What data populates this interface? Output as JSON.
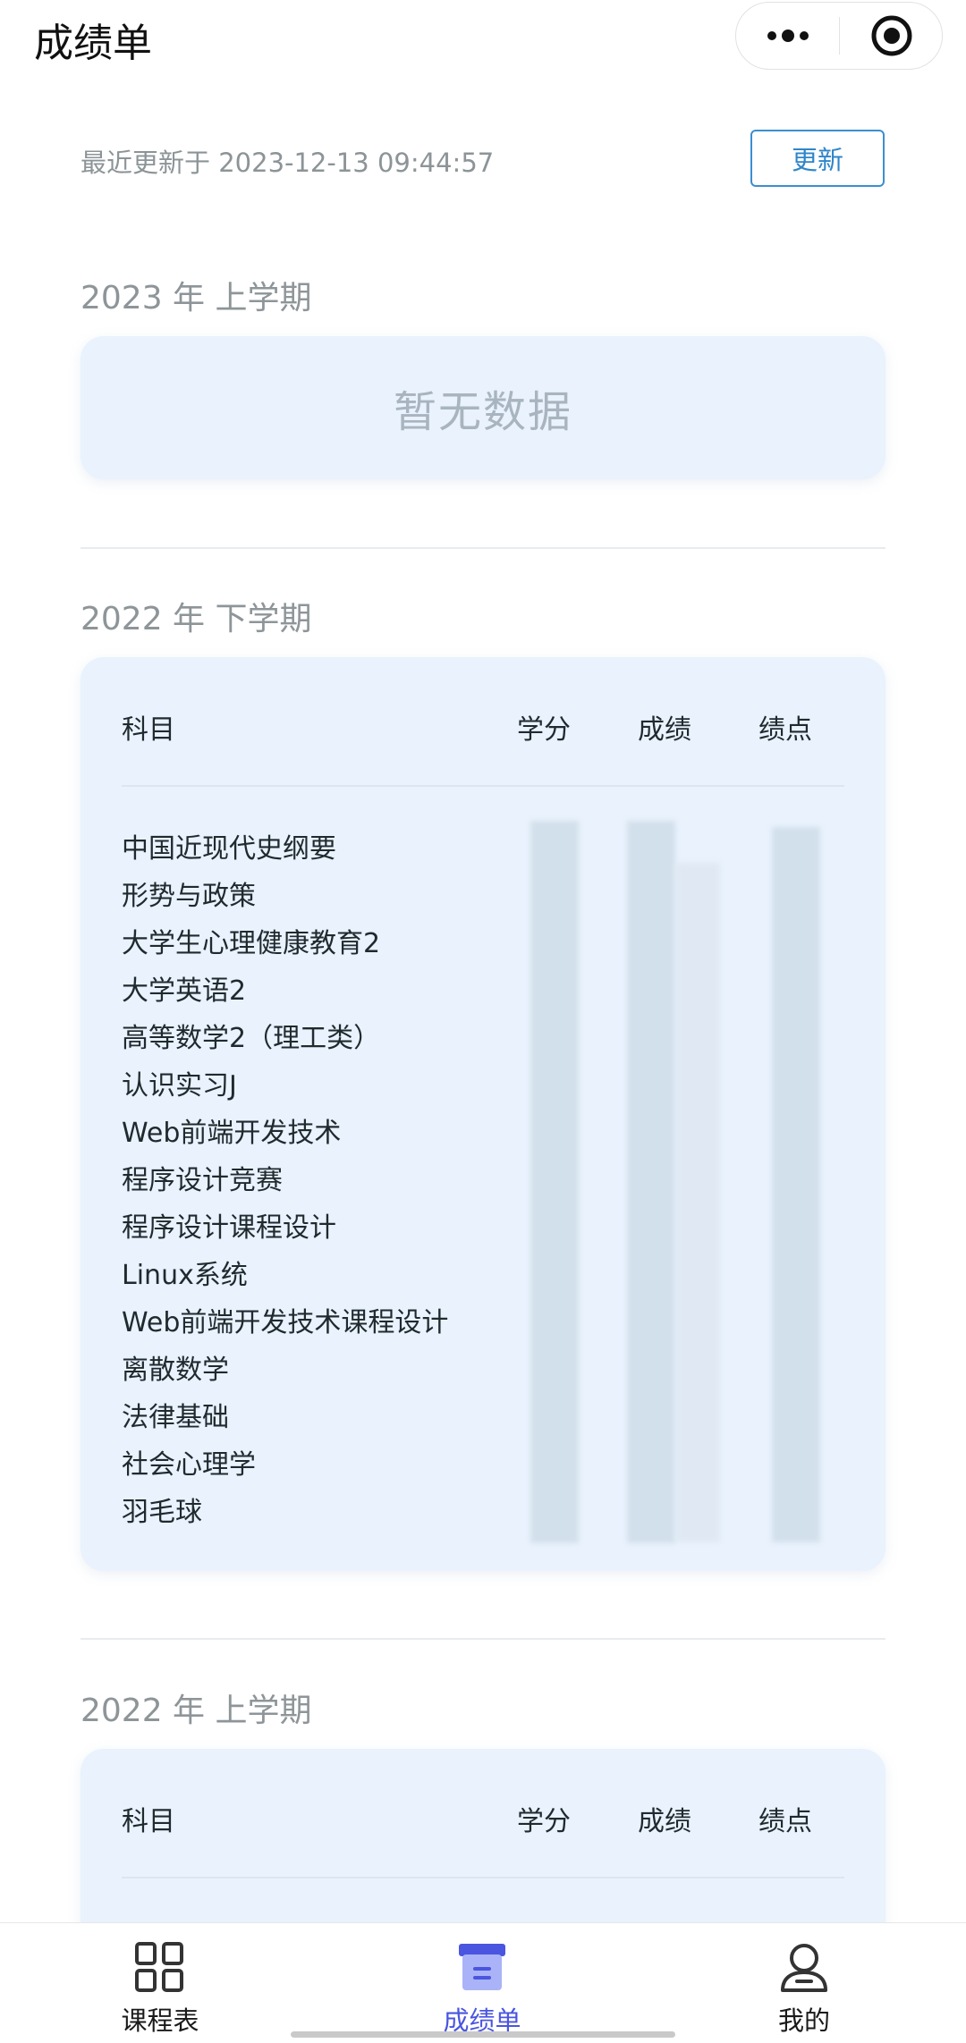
{
  "header": {
    "title": "成绩单",
    "capsule_icons": [
      "more-dots-icon",
      "target-icon"
    ]
  },
  "update": {
    "last_updated": "最近更新于 2023-12-13 09:44:57",
    "button_label": "更新"
  },
  "terms": [
    {
      "title": "2023 年 上学期",
      "empty_text": "暂无数据"
    },
    {
      "title": "2022 年 下学期",
      "columns": [
        "科目",
        "学分",
        "成绩",
        "绩点"
      ],
      "subjects": [
        "中国近现代史纲要",
        "形势与政策",
        "大学生心理健康教育2",
        "大学英语2",
        "高等数学2（理工类）",
        "认识实习J",
        "Web前端开发技术",
        "程序设计竞赛",
        "程序设计课程设计",
        "Linux系统",
        "Web前端开发技术课程设计",
        "离散数学",
        "法律基础",
        "社会心理学",
        "羽毛球"
      ]
    },
    {
      "title": "2022 年 上学期",
      "columns": [
        "科目",
        "学分",
        "成绩",
        "绩点"
      ]
    }
  ],
  "tabbar": {
    "items": [
      {
        "label": "课程表",
        "icon": "grid-icon",
        "active": false
      },
      {
        "label": "成绩单",
        "icon": "report-icon",
        "active": true
      },
      {
        "label": "我的",
        "icon": "user-icon",
        "active": false
      }
    ],
    "active_color": "#4a55e0"
  },
  "colors": {
    "accent": "#2f86c9",
    "card_bg": "#e9f2fd"
  }
}
